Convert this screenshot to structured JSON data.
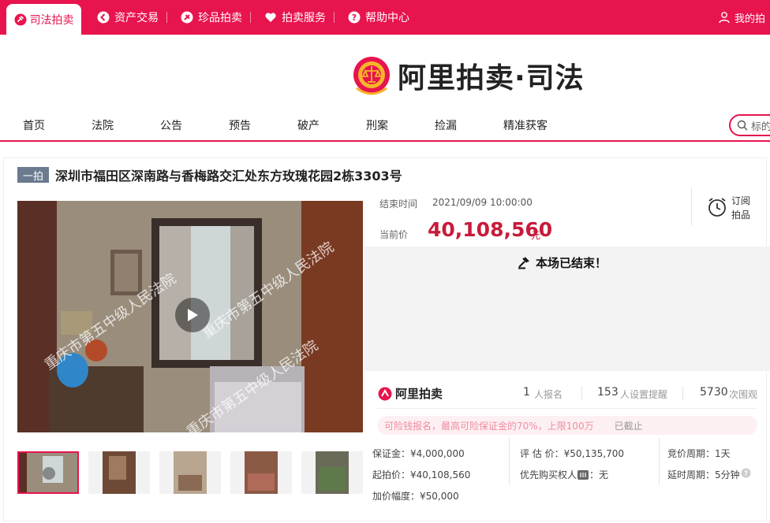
{
  "topnav": {
    "items": [
      {
        "label": "司法拍卖",
        "icon": "gavel-icon"
      },
      {
        "label": "资产交易",
        "icon": "asset-icon"
      },
      {
        "label": "珍品拍卖",
        "icon": "treasure-icon"
      },
      {
        "label": "拍卖服务",
        "icon": "heart-icon"
      },
      {
        "label": "帮助中心",
        "icon": "help-icon"
      }
    ],
    "my_label": "我的拍"
  },
  "logo": {
    "text": "阿里拍卖·司法"
  },
  "mainnav": {
    "items": [
      "首页",
      "法院",
      "公告",
      "预告",
      "破产",
      "刑案",
      "捡漏",
      "精准获客"
    ],
    "search_placeholder": "标的"
  },
  "auction": {
    "badge": "一拍",
    "title": "深圳市福田区深南路与香梅路交汇处东方玫瑰花园2栋3303号",
    "watermark": "重庆市第五中级人民法院",
    "end_time_label": "结束时间",
    "end_time": "2021/09/09 10:00:00",
    "price_label": "当前价",
    "current_price": "40,108,560",
    "price_unit": "元",
    "subscribe_line1": "订阅",
    "subscribe_line2": "拍品",
    "status": "本场已结束！",
    "platform": "阿里拍卖",
    "stats": [
      {
        "num": "1",
        "unit": "人报名"
      },
      {
        "num": "153",
        "unit": "人设置提醒"
      },
      {
        "num": "5730",
        "unit": "次围观"
      }
    ],
    "notice": "可险钱报名，最高可险保证金的70%，上限100万",
    "notice_status": "已截止",
    "deposit": "保证金：¥4,000,000",
    "start_price": "起拍价：¥40,108,560",
    "increment": "加价幅度：¥50,000",
    "appraisal": "评 估 价：¥50,135,700",
    "priority_label": "优先购买权人",
    "priority_value": "：无",
    "cycle": "竞价周期：1天",
    "delay": "延时周期：5分钟"
  },
  "colors": {
    "brand": "#e8144e",
    "price": "#c81b3a"
  }
}
